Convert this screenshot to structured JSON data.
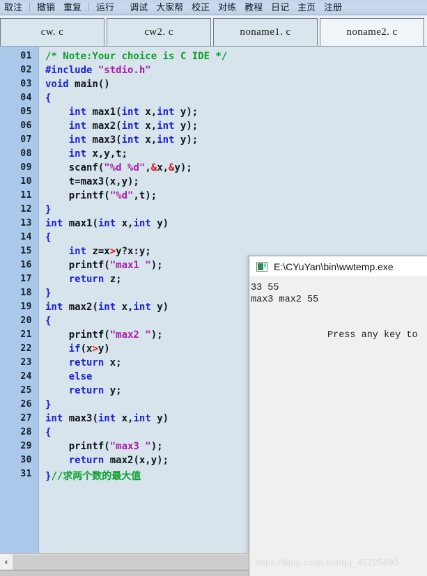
{
  "toolbar": {
    "items": [
      {
        "label": "取注",
        "sep_after": true
      },
      {
        "label": "撤销",
        "sep_after": false
      },
      {
        "label": "重复",
        "sep_after": true
      },
      {
        "label": "运行",
        "sep_after": false,
        "gap_after": true
      },
      {
        "label": "调试",
        "sep_after": false
      },
      {
        "label": "大家帮",
        "sep_after": false
      },
      {
        "label": "校正",
        "sep_after": false
      },
      {
        "label": "对练",
        "sep_after": false
      },
      {
        "label": "教程",
        "sep_after": false
      },
      {
        "label": "日记",
        "sep_after": false
      },
      {
        "label": "主页",
        "sep_after": false
      },
      {
        "label": "注册",
        "sep_after": false
      }
    ]
  },
  "tabs": [
    {
      "label": "cw. c",
      "active": false
    },
    {
      "label": "cw2. c",
      "active": false
    },
    {
      "label": "noname1. c",
      "active": false
    },
    {
      "label": "noname2. c",
      "active": true
    }
  ],
  "editor": {
    "line_numbers": [
      "01",
      "02",
      "03",
      "04",
      "05",
      "06",
      "07",
      "08",
      "09",
      "10",
      "11",
      "12",
      "13",
      "14",
      "15",
      "16",
      "17",
      "18",
      "19",
      "20",
      "21",
      "22",
      "23",
      "24",
      "25",
      "26",
      "27",
      "28",
      "29",
      "30",
      "31"
    ],
    "lines": [
      {
        "n": "01",
        "tokens": [
          {
            "t": "/* Note:Your choice is C IDE */",
            "c": "com"
          }
        ]
      },
      {
        "n": "02",
        "tokens": [
          {
            "t": "#include ",
            "c": "pre"
          },
          {
            "t": "\"stdio.h\"",
            "c": "str"
          }
        ]
      },
      {
        "n": "03",
        "tokens": [
          {
            "t": "void",
            "c": "kw"
          },
          {
            "t": " main()",
            "c": ""
          }
        ]
      },
      {
        "n": "04",
        "tokens": [
          {
            "t": "{",
            "c": "br"
          }
        ]
      },
      {
        "n": "05",
        "tokens": [
          {
            "t": "    ",
            "c": ""
          },
          {
            "t": "int",
            "c": "kw"
          },
          {
            "t": " max1(",
            "c": ""
          },
          {
            "t": "int",
            "c": "kw"
          },
          {
            "t": " x,",
            "c": ""
          },
          {
            "t": "int",
            "c": "kw"
          },
          {
            "t": " y);",
            "c": ""
          }
        ]
      },
      {
        "n": "06",
        "tokens": [
          {
            "t": "    ",
            "c": ""
          },
          {
            "t": "int",
            "c": "kw"
          },
          {
            "t": " max2(",
            "c": ""
          },
          {
            "t": "int",
            "c": "kw"
          },
          {
            "t": " x,",
            "c": ""
          },
          {
            "t": "int",
            "c": "kw"
          },
          {
            "t": " y);",
            "c": ""
          }
        ]
      },
      {
        "n": "07",
        "tokens": [
          {
            "t": "    ",
            "c": ""
          },
          {
            "t": "int",
            "c": "kw"
          },
          {
            "t": " max3(",
            "c": ""
          },
          {
            "t": "int",
            "c": "kw"
          },
          {
            "t": " x,",
            "c": ""
          },
          {
            "t": "int",
            "c": "kw"
          },
          {
            "t": " y);",
            "c": ""
          }
        ]
      },
      {
        "n": "08",
        "tokens": [
          {
            "t": "    ",
            "c": ""
          },
          {
            "t": "int",
            "c": "kw"
          },
          {
            "t": " x,y,t;",
            "c": ""
          }
        ]
      },
      {
        "n": "09",
        "tokens": [
          {
            "t": "    scanf(",
            "c": ""
          },
          {
            "t": "\"%d %d\"",
            "c": "str"
          },
          {
            "t": ",",
            "c": ""
          },
          {
            "t": "&",
            "c": "op"
          },
          {
            "t": "x,",
            "c": ""
          },
          {
            "t": "&",
            "c": "op"
          },
          {
            "t": "y);",
            "c": ""
          }
        ]
      },
      {
        "n": "10",
        "tokens": [
          {
            "t": "    t=max3(x,y);",
            "c": ""
          }
        ]
      },
      {
        "n": "11",
        "tokens": [
          {
            "t": "    printf(",
            "c": ""
          },
          {
            "t": "\"%d\"",
            "c": "str"
          },
          {
            "t": ",t);",
            "c": ""
          }
        ]
      },
      {
        "n": "12",
        "tokens": [
          {
            "t": "}",
            "c": "br"
          }
        ]
      },
      {
        "n": "13",
        "tokens": [
          {
            "t": "int",
            "c": "kw"
          },
          {
            "t": " max1(",
            "c": ""
          },
          {
            "t": "int",
            "c": "kw"
          },
          {
            "t": " x,",
            "c": ""
          },
          {
            "t": "int",
            "c": "kw"
          },
          {
            "t": " y)",
            "c": ""
          }
        ]
      },
      {
        "n": "14",
        "tokens": [
          {
            "t": "{",
            "c": "br"
          }
        ]
      },
      {
        "n": "15",
        "tokens": [
          {
            "t": "    ",
            "c": ""
          },
          {
            "t": "int",
            "c": "kw"
          },
          {
            "t": " z=x",
            "c": ""
          },
          {
            "t": ">",
            "c": "op"
          },
          {
            "t": "y?x:y;",
            "c": ""
          }
        ]
      },
      {
        "n": "16",
        "tokens": [
          {
            "t": "    printf(",
            "c": ""
          },
          {
            "t": "\"max1 \"",
            "c": "str"
          },
          {
            "t": ");",
            "c": ""
          }
        ]
      },
      {
        "n": "17",
        "tokens": [
          {
            "t": "    ",
            "c": ""
          },
          {
            "t": "return",
            "c": "kw"
          },
          {
            "t": " z;",
            "c": ""
          }
        ]
      },
      {
        "n": "18",
        "tokens": [
          {
            "t": "}",
            "c": "br"
          }
        ]
      },
      {
        "n": "19",
        "tokens": [
          {
            "t": "int",
            "c": "kw"
          },
          {
            "t": " max2(",
            "c": ""
          },
          {
            "t": "int",
            "c": "kw"
          },
          {
            "t": " x,",
            "c": ""
          },
          {
            "t": "int",
            "c": "kw"
          },
          {
            "t": " y)",
            "c": ""
          }
        ]
      },
      {
        "n": "20",
        "tokens": [
          {
            "t": "{",
            "c": "br"
          }
        ]
      },
      {
        "n": "21",
        "tokens": [
          {
            "t": "    printf(",
            "c": ""
          },
          {
            "t": "\"max2 \"",
            "c": "str"
          },
          {
            "t": ");",
            "c": ""
          }
        ]
      },
      {
        "n": "22",
        "tokens": [
          {
            "t": "    ",
            "c": ""
          },
          {
            "t": "if",
            "c": "kw"
          },
          {
            "t": "(x",
            "c": ""
          },
          {
            "t": ">",
            "c": "op"
          },
          {
            "t": "y)",
            "c": ""
          }
        ]
      },
      {
        "n": "23",
        "tokens": [
          {
            "t": "    ",
            "c": ""
          },
          {
            "t": "return",
            "c": "kw"
          },
          {
            "t": " x;",
            "c": ""
          }
        ]
      },
      {
        "n": "24",
        "tokens": [
          {
            "t": "    ",
            "c": ""
          },
          {
            "t": "else",
            "c": "kw"
          }
        ]
      },
      {
        "n": "25",
        "tokens": [
          {
            "t": "    ",
            "c": ""
          },
          {
            "t": "return",
            "c": "kw"
          },
          {
            "t": " y;",
            "c": ""
          }
        ]
      },
      {
        "n": "26",
        "tokens": [
          {
            "t": "}",
            "c": "br"
          }
        ]
      },
      {
        "n": "27",
        "tokens": [
          {
            "t": "int",
            "c": "kw"
          },
          {
            "t": " max3(",
            "c": ""
          },
          {
            "t": "int",
            "c": "kw"
          },
          {
            "t": " x,",
            "c": ""
          },
          {
            "t": "int",
            "c": "kw"
          },
          {
            "t": " y)",
            "c": ""
          }
        ]
      },
      {
        "n": "28",
        "tokens": [
          {
            "t": "{",
            "c": "br"
          }
        ]
      },
      {
        "n": "29",
        "tokens": [
          {
            "t": "    printf(",
            "c": ""
          },
          {
            "t": "\"max3 \"",
            "c": "str"
          },
          {
            "t": ");",
            "c": ""
          }
        ]
      },
      {
        "n": "30",
        "tokens": [
          {
            "t": "    ",
            "c": ""
          },
          {
            "t": "return",
            "c": "kw"
          },
          {
            "t": " max2(x,y);",
            "c": ""
          }
        ]
      },
      {
        "n": "31",
        "tokens": [
          {
            "t": "}",
            "c": "br"
          },
          {
            "t": "//求两个数的最大值",
            "c": "com"
          }
        ]
      }
    ]
  },
  "console": {
    "title": "E:\\CYuYan\\bin\\wwtemp.exe",
    "icon": "console-window-icon",
    "output_lines": [
      "33 55",
      "max3 max2 55"
    ],
    "prompt": "Press any key to"
  },
  "watermark": "https://blog.csdn.net/qq_45725890",
  "scrollbar": {
    "left_arrow": "‹"
  },
  "colors": {
    "keyword": "#1a22d8",
    "string": "#a81ba8",
    "comment": "#0aa02a",
    "operator": "#e21212",
    "editor_bg": "#d7e4ec",
    "gutter_bg": "#a9c8ea",
    "toolbar_bg": "#c8d8ec"
  }
}
